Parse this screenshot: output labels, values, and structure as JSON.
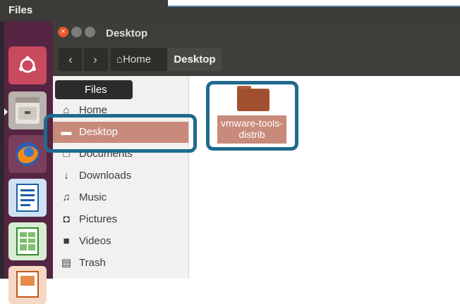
{
  "topbar": {
    "title": "Files"
  },
  "window": {
    "title": "Desktop",
    "nav": {
      "back": "‹",
      "forward": "›"
    },
    "breadcrumbs": {
      "home": "Home",
      "current": "Desktop"
    }
  },
  "tooltip": {
    "label": "Files"
  },
  "sidebar": {
    "items": [
      {
        "label": "Home",
        "icon": "home-icon"
      },
      {
        "label": "Desktop",
        "icon": "folder-icon"
      },
      {
        "label": "Documents",
        "icon": "document-icon"
      },
      {
        "label": "Downloads",
        "icon": "download-icon"
      },
      {
        "label": "Music",
        "icon": "music-icon"
      },
      {
        "label": "Pictures",
        "icon": "camera-icon"
      },
      {
        "label": "Videos",
        "icon": "video-icon"
      },
      {
        "label": "Trash",
        "icon": "trash-icon"
      }
    ]
  },
  "main": {
    "folder_label": "vmware-tools-distrib"
  },
  "colors": {
    "accent": "#1f6b8f",
    "selection": "#c88a7a",
    "panel": "#3c3b37",
    "launcher": "#562543"
  }
}
